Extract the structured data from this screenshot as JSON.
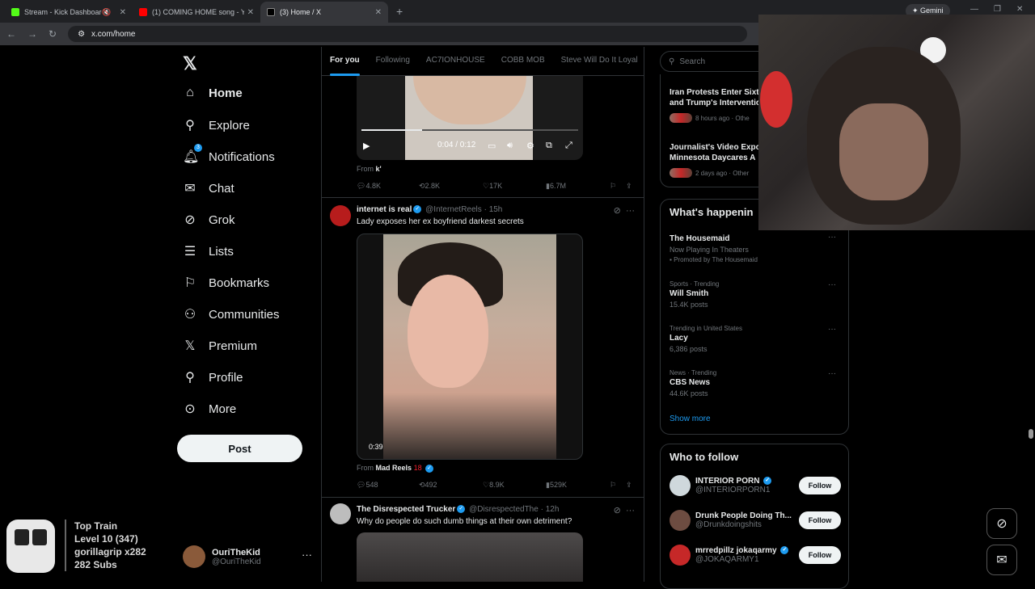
{
  "browser": {
    "tabs": [
      {
        "label": "Stream - Kick Dashboard",
        "active": false
      },
      {
        "label": "(1) COMING HOME song - YouT",
        "active": false
      },
      {
        "label": "(3) Home / X",
        "active": true
      }
    ],
    "gemini_label": "Gemini",
    "url": "x.com/home"
  },
  "nav": {
    "items": [
      {
        "label": "Home",
        "icon": "home-icon"
      },
      {
        "label": "Explore",
        "icon": "search-icon"
      },
      {
        "label": "Notifications",
        "icon": "bell-icon",
        "badge": "3"
      },
      {
        "label": "Chat",
        "icon": "mail-icon"
      },
      {
        "label": "Grok",
        "icon": "grok-icon"
      },
      {
        "label": "Lists",
        "icon": "list-icon"
      },
      {
        "label": "Bookmarks",
        "icon": "bookmark-icon"
      },
      {
        "label": "Communities",
        "icon": "people-icon"
      },
      {
        "label": "Premium",
        "icon": "x-logo-icon"
      },
      {
        "label": "Profile",
        "icon": "person-icon"
      },
      {
        "label": "More",
        "icon": "more-circle-icon"
      }
    ],
    "post_label": "Post",
    "account": {
      "name": "OuriTheKid",
      "handle": "@OuriTheKid"
    }
  },
  "feed": {
    "tabs": [
      "For you",
      "Following",
      "AC7IONHOUSE",
      "COBB MOB",
      "Steve Will Do It Loyal"
    ],
    "post1": {
      "time": "0:04 / 0:12",
      "progress": 0.28,
      "from_prefix": "From",
      "from_name": "k'",
      "replies": "4.8K",
      "reposts": "2.8K",
      "likes": "17K",
      "views": "6.7M"
    },
    "post2": {
      "author": "internet is real",
      "handle": "@InternetReels",
      "time": "15h",
      "text": "Lady exposes her ex boyfriend darkest secrets",
      "duration": "0:39",
      "from_prefix": "From",
      "from_name": "Mad Reels",
      "from_badge": "18",
      "replies": "548",
      "reposts": "492",
      "likes": "8.9K",
      "views": "529K"
    },
    "post3": {
      "author": "The Disrespected Trucker",
      "handle": "@DisrespectedThe",
      "time": "12h",
      "text": "Why do people do such dumb things at their own detriment?"
    }
  },
  "sidebar": {
    "search_placeholder": "Search",
    "news": [
      {
        "title": "Iran Protests Enter Sixt and Trump's Interventio",
        "meta": "8 hours ago · Othe"
      },
      {
        "title": "Journalist's Video Expo Minnesota Daycares A",
        "meta": "2 days ago · Other"
      }
    ],
    "happening_title": "What's happenin",
    "trends": [
      {
        "category": "",
        "name": "The Housemaid",
        "sub": "Now Playing In Theaters",
        "promo": "Promoted by The Housemaid"
      },
      {
        "category": "Sports · Trending",
        "name": "Will Smith",
        "sub": "15.4K posts"
      },
      {
        "category": "Trending in United States",
        "name": "Lacy",
        "sub": "6,386 posts"
      },
      {
        "category": "News · Trending",
        "name": "CBS News",
        "sub": "44.6K posts"
      }
    ],
    "show_more": "Show more",
    "who_to_follow_title": "Who to follow",
    "follow_label": "Follow",
    "who_to_follow": [
      {
        "name": "INTERIOR PORN",
        "handle": "@INTERIORPORN1",
        "verified": true
      },
      {
        "name": "Drunk People Doing Th...",
        "handle": "@Drunkdoingshits",
        "verified": false
      },
      {
        "name": "mrredpillz jokaqarmy",
        "handle": "@JOKAQARMY1",
        "verified": true
      }
    ]
  },
  "overlay": {
    "line1": "Top Train",
    "line2": "Level 10  (347)",
    "line3": "gorillagrip x282",
    "line4": "282 Subs"
  },
  "colors": {
    "accent": "#1d9bf0",
    "background": "#000000",
    "border": "#2f3336"
  }
}
